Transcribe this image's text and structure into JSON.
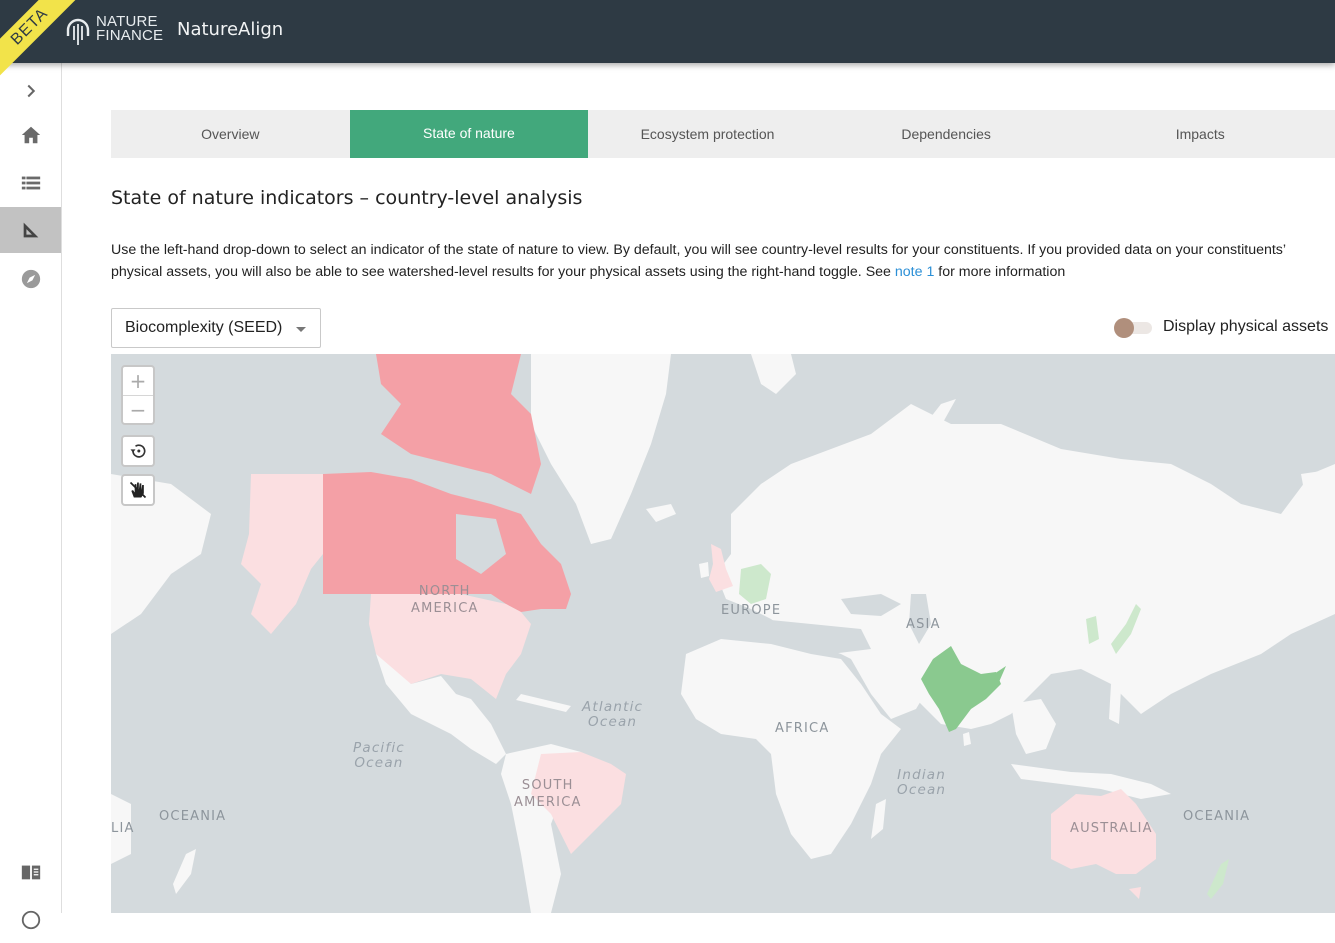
{
  "header": {
    "beta_badge": "BETA",
    "logo_line1": "NATURE",
    "logo_line2": "FINANCE",
    "app_name": "NatureAlign"
  },
  "sidebar": {
    "items": [
      {
        "icon": "chevron-right-icon",
        "label": "Expand sidebar",
        "active": false
      },
      {
        "icon": "home-icon",
        "label": "Home",
        "active": false
      },
      {
        "icon": "list-icon",
        "label": "Portfolio list",
        "active": false
      },
      {
        "icon": "set-square-icon",
        "label": "Analysis",
        "active": true
      },
      {
        "icon": "compass-icon",
        "label": "Explore",
        "active": false
      },
      {
        "icon": "book-icon",
        "label": "Documentation",
        "active": false
      },
      {
        "icon": "help-icon",
        "label": "Help",
        "active": false
      }
    ]
  },
  "tabs": [
    {
      "label": "Overview",
      "active": false
    },
    {
      "label": "State of nature",
      "active": true
    },
    {
      "label": "Ecosystem protection",
      "active": false
    },
    {
      "label": "Dependencies",
      "active": false
    },
    {
      "label": "Impacts",
      "active": false
    }
  ],
  "main": {
    "title": "State of nature indicators – country-level analysis",
    "description_before_link": "Use the left-hand drop-down to select an indicator of the state of nature to view. By default, you will see country-level results for your constituents. If you provided data on your constituents’ physical assets, you will also be able to see watershed-level results for your physical assets using the right-hand toggle. See ",
    "description_link": "note 1",
    "description_after_link": " for more information",
    "indicator_select": {
      "value": "Biocomplexity (SEED)"
    },
    "physical_assets_toggle": {
      "label": "Display physical assets",
      "checked": false
    }
  },
  "map": {
    "controls": {
      "zoom_in": "+",
      "zoom_out": "−",
      "reset": "reset-view-icon",
      "pan": "hand-icon"
    },
    "colors": {
      "ocean": "#d4dadd",
      "land": "#f7f7f7",
      "low_red": "#f4a0a6",
      "light_red": "#fbdfe1",
      "green": "#8ac98f",
      "light_green": "#cde8cc"
    },
    "highlighted_countries": [
      {
        "name": "Canada",
        "category": "low_red"
      },
      {
        "name": "United States",
        "category": "light_red"
      },
      {
        "name": "Brazil",
        "category": "light_red"
      },
      {
        "name": "Australia",
        "category": "light_red"
      },
      {
        "name": "United Kingdom",
        "category": "light_red"
      },
      {
        "name": "Germany",
        "category": "light_green"
      },
      {
        "name": "India",
        "category": "green"
      },
      {
        "name": "Japan",
        "category": "light_green"
      },
      {
        "name": "South Korea",
        "category": "light_green"
      },
      {
        "name": "New Zealand",
        "category": "light_green"
      }
    ],
    "labels": {
      "north_america_1": "NORTH",
      "north_america_2": "AMERICA",
      "south_america_1": "SOUTH",
      "south_america_2": "AMERICA",
      "europe": "EUROPE",
      "asia": "ASIA",
      "africa": "AFRICA",
      "australia": "AUSTRALIA",
      "oceania_left": "OCEANIA",
      "oceania_right": "OCEANIA",
      "australia_clipped": "LIA",
      "atlantic_1": "Atlantic",
      "atlantic_2": "Ocean",
      "pacific_1": "Pacific",
      "pacific_2": "Ocean",
      "indian_1": "Indian",
      "indian_2": "Ocean"
    }
  }
}
